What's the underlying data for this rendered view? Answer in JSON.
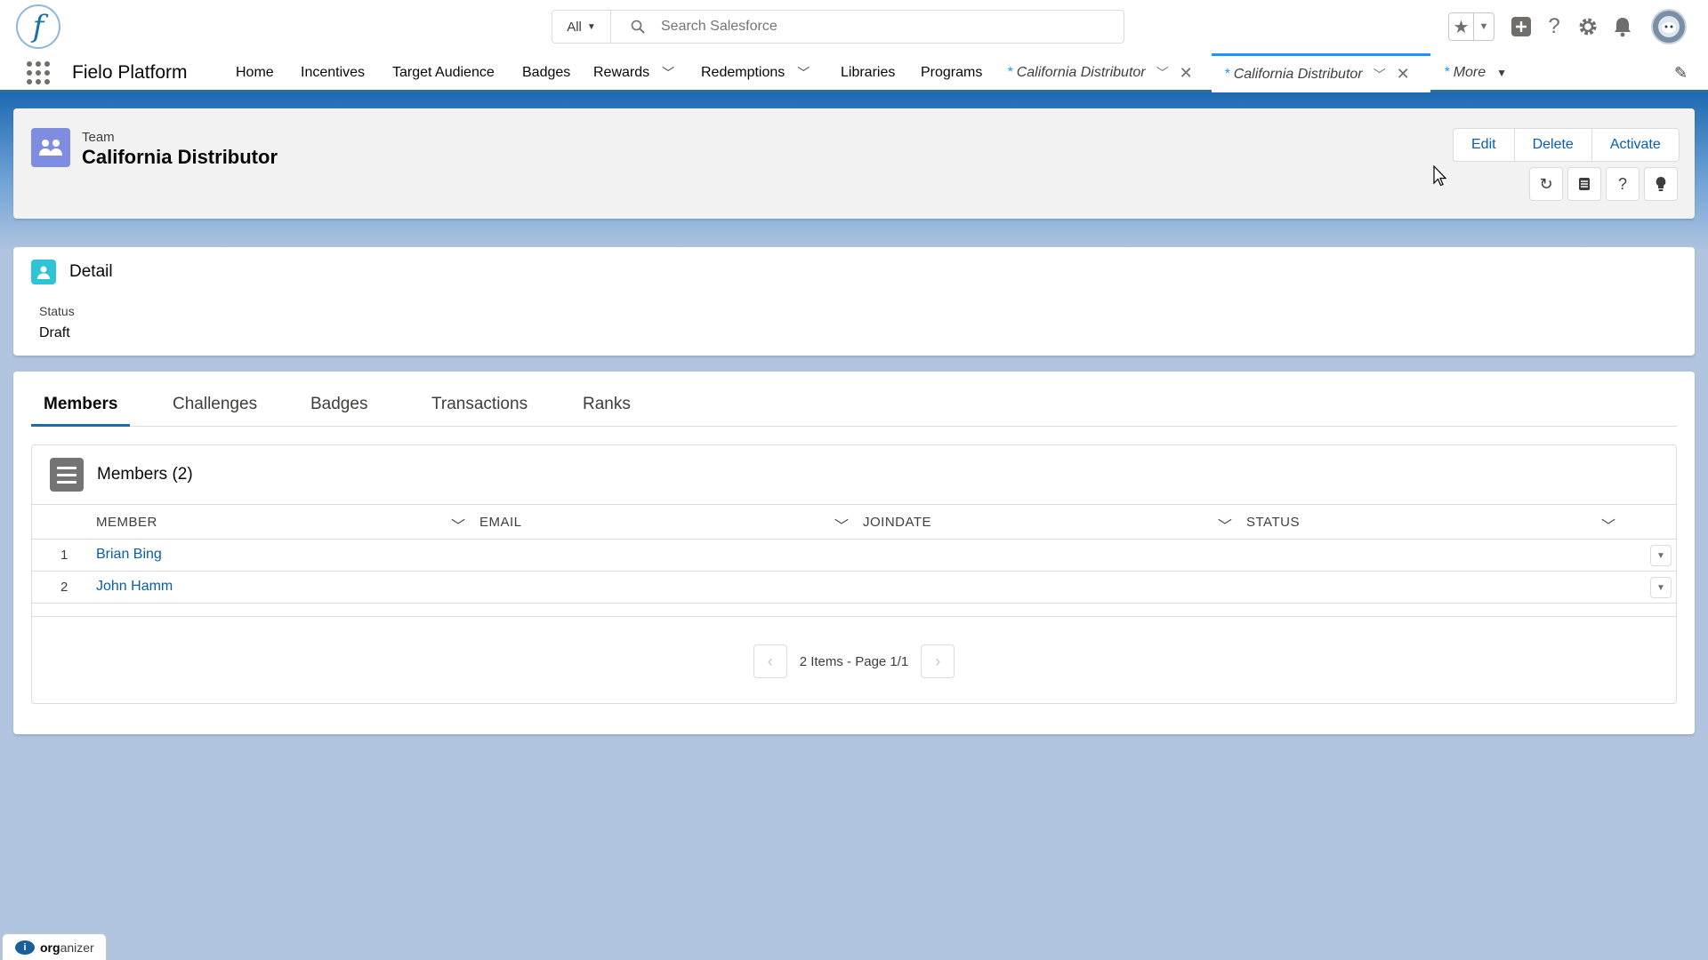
{
  "header": {
    "logo_letter": "f",
    "search_scope": "All",
    "search_placeholder": "Search Salesforce"
  },
  "nav": {
    "app_name": "Fielo Platform",
    "items": [
      {
        "label": "Home"
      },
      {
        "label": "Incentives"
      },
      {
        "label": "Target Audience"
      },
      {
        "label": "Badges"
      },
      {
        "label": "Rewards"
      },
      {
        "label": "Redemptions"
      },
      {
        "label": "Libraries"
      },
      {
        "label": "Programs"
      }
    ],
    "tabs": [
      {
        "prefix": "*",
        "label": "California Distributor",
        "active": false
      },
      {
        "prefix": "*",
        "label": "California Distributor",
        "active": true
      }
    ],
    "more": {
      "prefix": "*",
      "label": "More"
    }
  },
  "record": {
    "type": "Team",
    "title": "California Distributor",
    "actions": [
      "Edit",
      "Delete",
      "Activate"
    ]
  },
  "detail": {
    "title": "Detail",
    "fields": [
      {
        "label": "Status",
        "value": "Draft"
      }
    ]
  },
  "related": {
    "tabs": [
      "Members",
      "Challenges",
      "Badges",
      "Transactions",
      "Ranks"
    ],
    "active_tab": "Members",
    "list_title": "Members (2)",
    "columns": [
      "MEMBER",
      "EMAIL",
      "JOINDATE",
      "STATUS"
    ],
    "rows": [
      {
        "num": "1",
        "member": "Brian Bing"
      },
      {
        "num": "2",
        "member": "John Hamm"
      }
    ],
    "pager_text": "2 Items - Page 1/1"
  },
  "utility": {
    "app_prefix": "org",
    "app_suffix": "anizer"
  },
  "colors": {
    "brand_blue": "#1b6ab3",
    "link_blue": "#0b5cab",
    "team_icon": "#7f8de1",
    "detail_icon": "#2ec4d6",
    "page_bg": "#b0c4df"
  }
}
